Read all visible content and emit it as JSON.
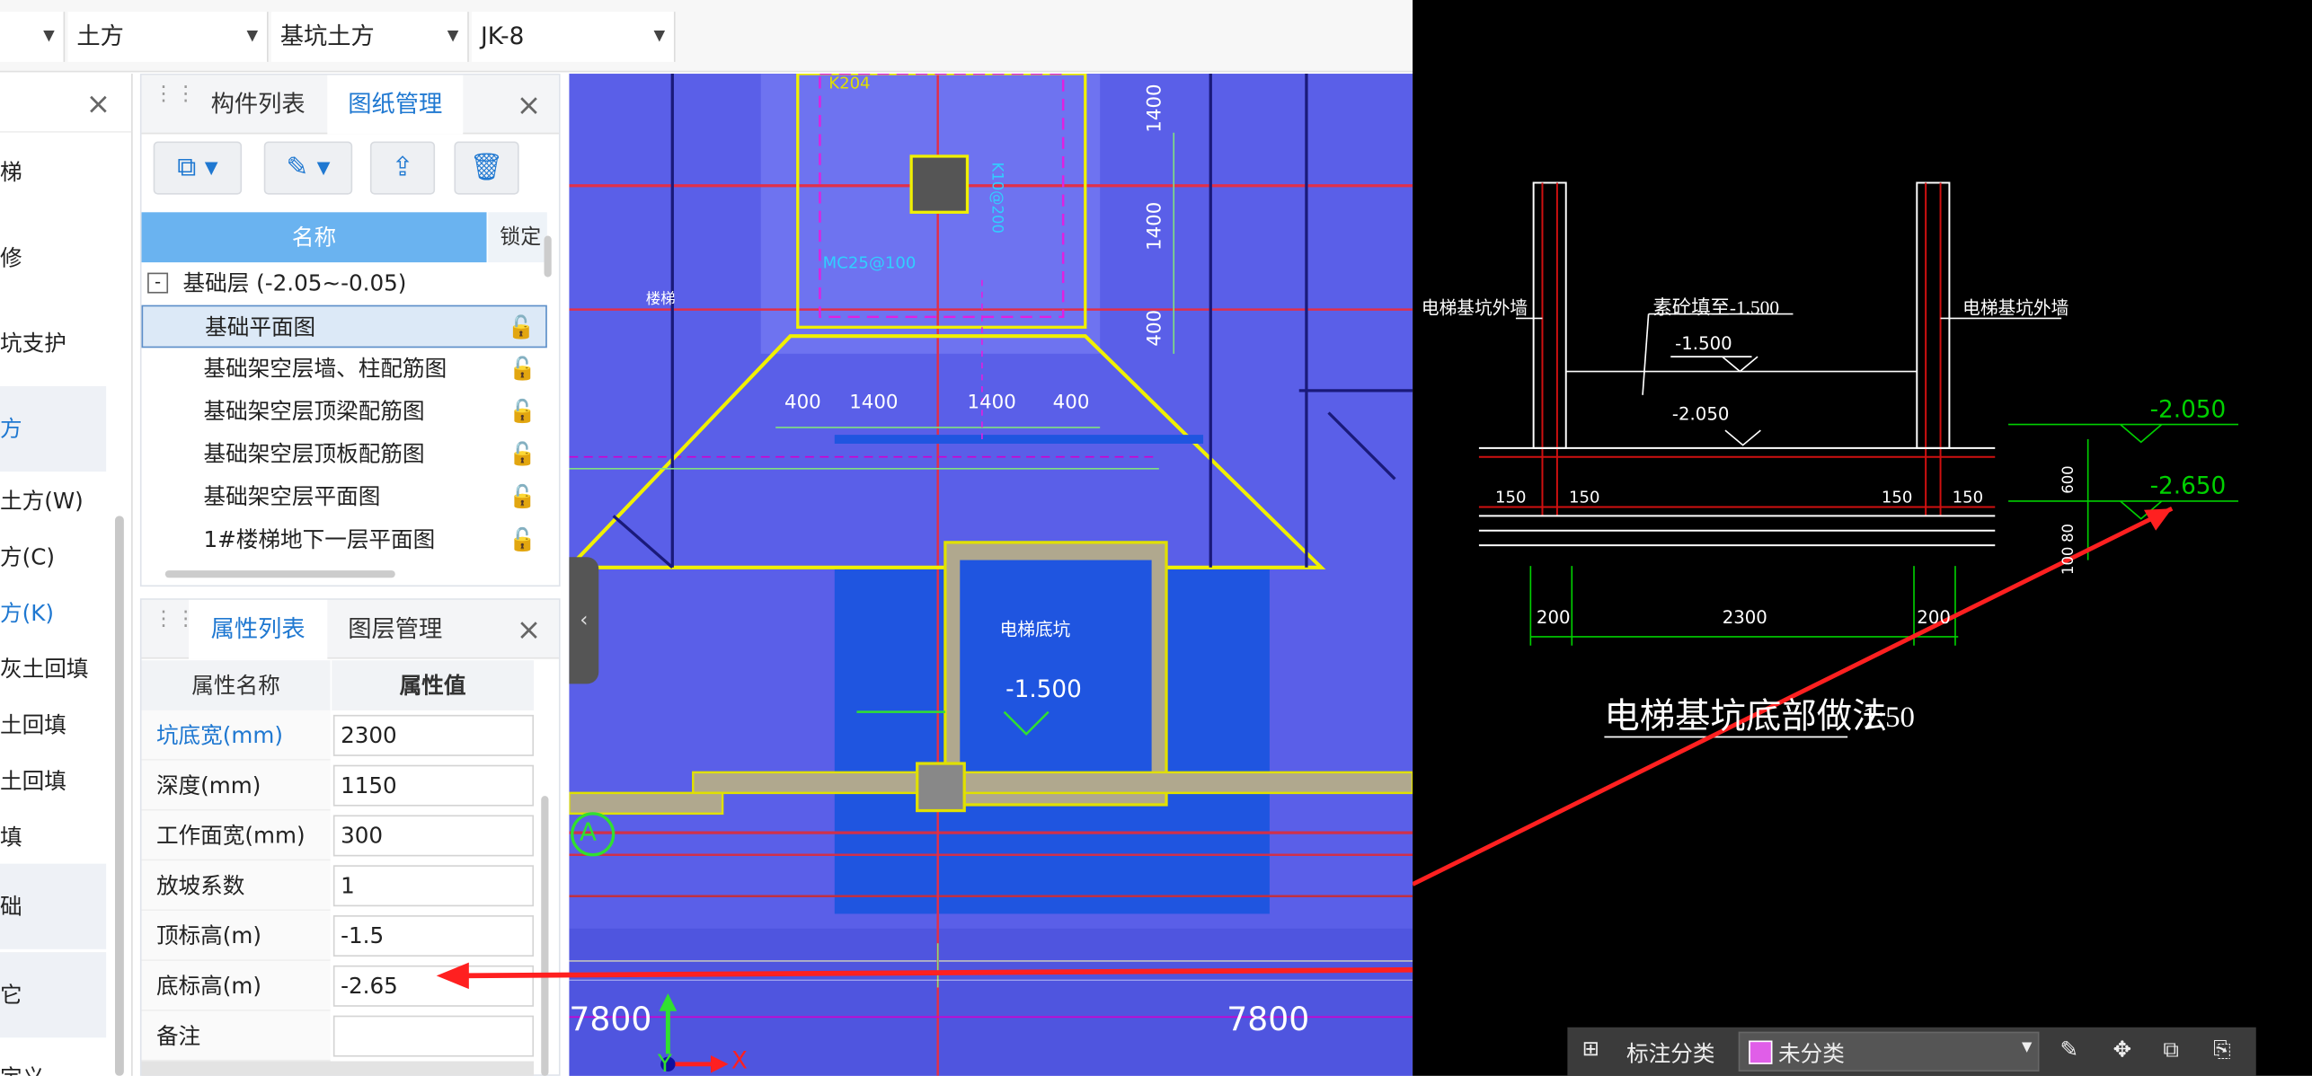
{
  "toolbar": {
    "dropdowns": [
      {
        "label": ""
      },
      {
        "label": "土方"
      },
      {
        "label": "基坑土方"
      },
      {
        "label": "JK-8"
      }
    ]
  },
  "left_nav": {
    "items": [
      "梯",
      "修",
      "坑支护",
      "方",
      "土方(W)",
      "方(C)",
      "方(K)",
      "灰土回填",
      "土回填",
      "土回填",
      "填",
      "础",
      "它",
      "定义"
    ]
  },
  "component_panel": {
    "tabs": [
      "构件列表",
      "图纸管理"
    ],
    "table_headers": [
      "名称",
      "锁定"
    ],
    "group": "基础层 (-2.05~-0.05)",
    "group_toggle": "-",
    "rows": [
      "基础平面图",
      "基础架空层墙、柱配筋图",
      "基础架空层顶梁配筋图",
      "基础架空层顶板配筋图",
      "基础架空层平面图",
      "1#楼梯地下一层平面图"
    ]
  },
  "property_panel": {
    "tabs": [
      "属性列表",
      "图层管理"
    ],
    "headers": [
      "属性名称",
      "属性值"
    ],
    "rows": [
      {
        "name": "坑底宽(mm)",
        "value": "2300"
      },
      {
        "name": "深度(mm)",
        "value": "1150"
      },
      {
        "name": "工作面宽(mm)",
        "value": "300"
      },
      {
        "name": "放坡系数",
        "value": "1"
      },
      {
        "name": "顶标高(m)",
        "value": "-1.5"
      },
      {
        "name": "底标高(m)",
        "value": "-2.65"
      },
      {
        "name": "备注",
        "value": ""
      }
    ]
  },
  "cad_plan": {
    "labels": {
      "pit_name": "电梯底坑",
      "elev": "-1.500",
      "grid_a": "A",
      "dim_left": "7800",
      "dim_right": "7800",
      "dims_h": [
        "400",
        "1400",
        "1400",
        "400"
      ],
      "dims_v": [
        "1400",
        "1400",
        "400"
      ],
      "axis_y": "Y",
      "axis_x": "X",
      "k204": "K204",
      "mc": "MC25@100",
      "misc": "K10@200",
      "stair": "楼梯"
    }
  },
  "cad_detail": {
    "title": "电梯基坑底部做法",
    "scale": "1:50",
    "wall_left": "电梯基坑外墙",
    "wall_right": "电梯基坑外墙",
    "fill_note": "素砼填至-1.500",
    "elev_1": "-1.500",
    "elev_2": "-2.050",
    "elev_r1": "-2.050",
    "elev_r2": "-2.650",
    "dims": [
      "150",
      "150",
      "150",
      "150"
    ],
    "dims_bottom": [
      "200",
      "2300",
      "200"
    ],
    "dims_right": [
      "600",
      "80",
      "100"
    ]
  },
  "statusbar": {
    "label": "标注分类",
    "value": "未分类",
    "swatch_color": "#e05ee8"
  },
  "colors": {
    "cad_blue": "#5a5fe8",
    "accent": "#1f78d1",
    "red_arrow": "#ff2020",
    "cad_yellow": "#f0f000",
    "cad_green": "#00d000"
  }
}
